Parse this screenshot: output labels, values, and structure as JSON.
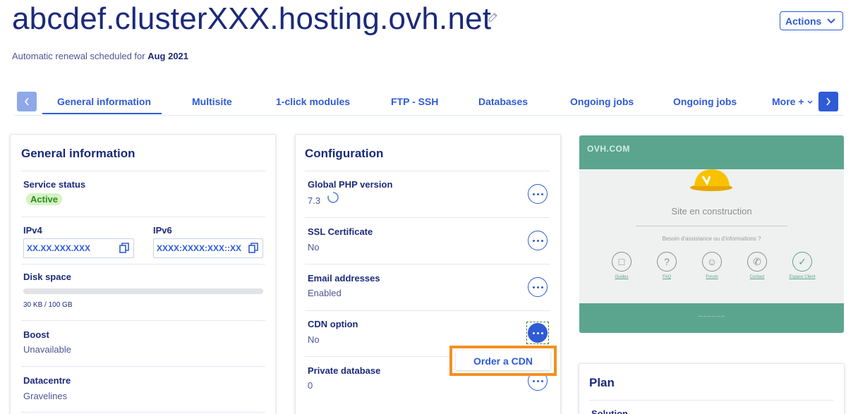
{
  "header": {
    "title": "abcdef.clusterXXX.hosting.ovh.net",
    "renewal_prefix": "Automatic renewal scheduled for ",
    "renewal_date": "Aug 2021",
    "actions_label": "Actions"
  },
  "tabs": [
    {
      "label": "General information",
      "active": true
    },
    {
      "label": "Multisite"
    },
    {
      "label": "1-click modules"
    },
    {
      "label": "FTP - SSH"
    },
    {
      "label": "Databases"
    },
    {
      "label": "Ongoing jobs"
    },
    {
      "label": "Ongoing jobs"
    },
    {
      "label": "More +"
    }
  ],
  "general": {
    "title": "General information",
    "service_status_label": "Service status",
    "service_status_value": "Active",
    "ipv4_label": "IPv4",
    "ipv4_value": "XX.XX.XXX.XXX",
    "ipv6_label": "IPv6",
    "ipv6_value": "XXXX:XXXX:XXX::XX",
    "disk_label": "Disk space",
    "disk_value": "30 KB / 100 GB",
    "disk_fraction": 0.0,
    "boost_label": "Boost",
    "boost_value": "Unavailable",
    "datacentre_label": "Datacentre",
    "datacentre_value": "Gravelines"
  },
  "configuration": {
    "title": "Configuration",
    "php_label": "Global PHP version",
    "php_value": "7.3",
    "ssl_label": "SSL Certificate",
    "ssl_value": "No",
    "email_label": "Email addresses",
    "email_value": "Enabled",
    "cdn_label": "CDN option",
    "cdn_value": "No",
    "private_db_label": "Private database",
    "private_db_value": "0",
    "order_cdn_label": "Order a CDN"
  },
  "preview": {
    "logo": "OVH.COM",
    "heading": "Site en construction",
    "subheading": "Besoin d'assistance ou d'informations ?",
    "links": [
      "Guides",
      "FAQ",
      "Forum",
      "Contact",
      "Espace Client"
    ]
  },
  "plan": {
    "title": "Plan",
    "first_row_label": "Solution"
  },
  "colors": {
    "accent": "#2e5bd6",
    "title": "#1b2a7a",
    "active_badge_bg": "#d5f3c4",
    "highlight": "#f5901e",
    "preview_green": "#5ba58e"
  }
}
